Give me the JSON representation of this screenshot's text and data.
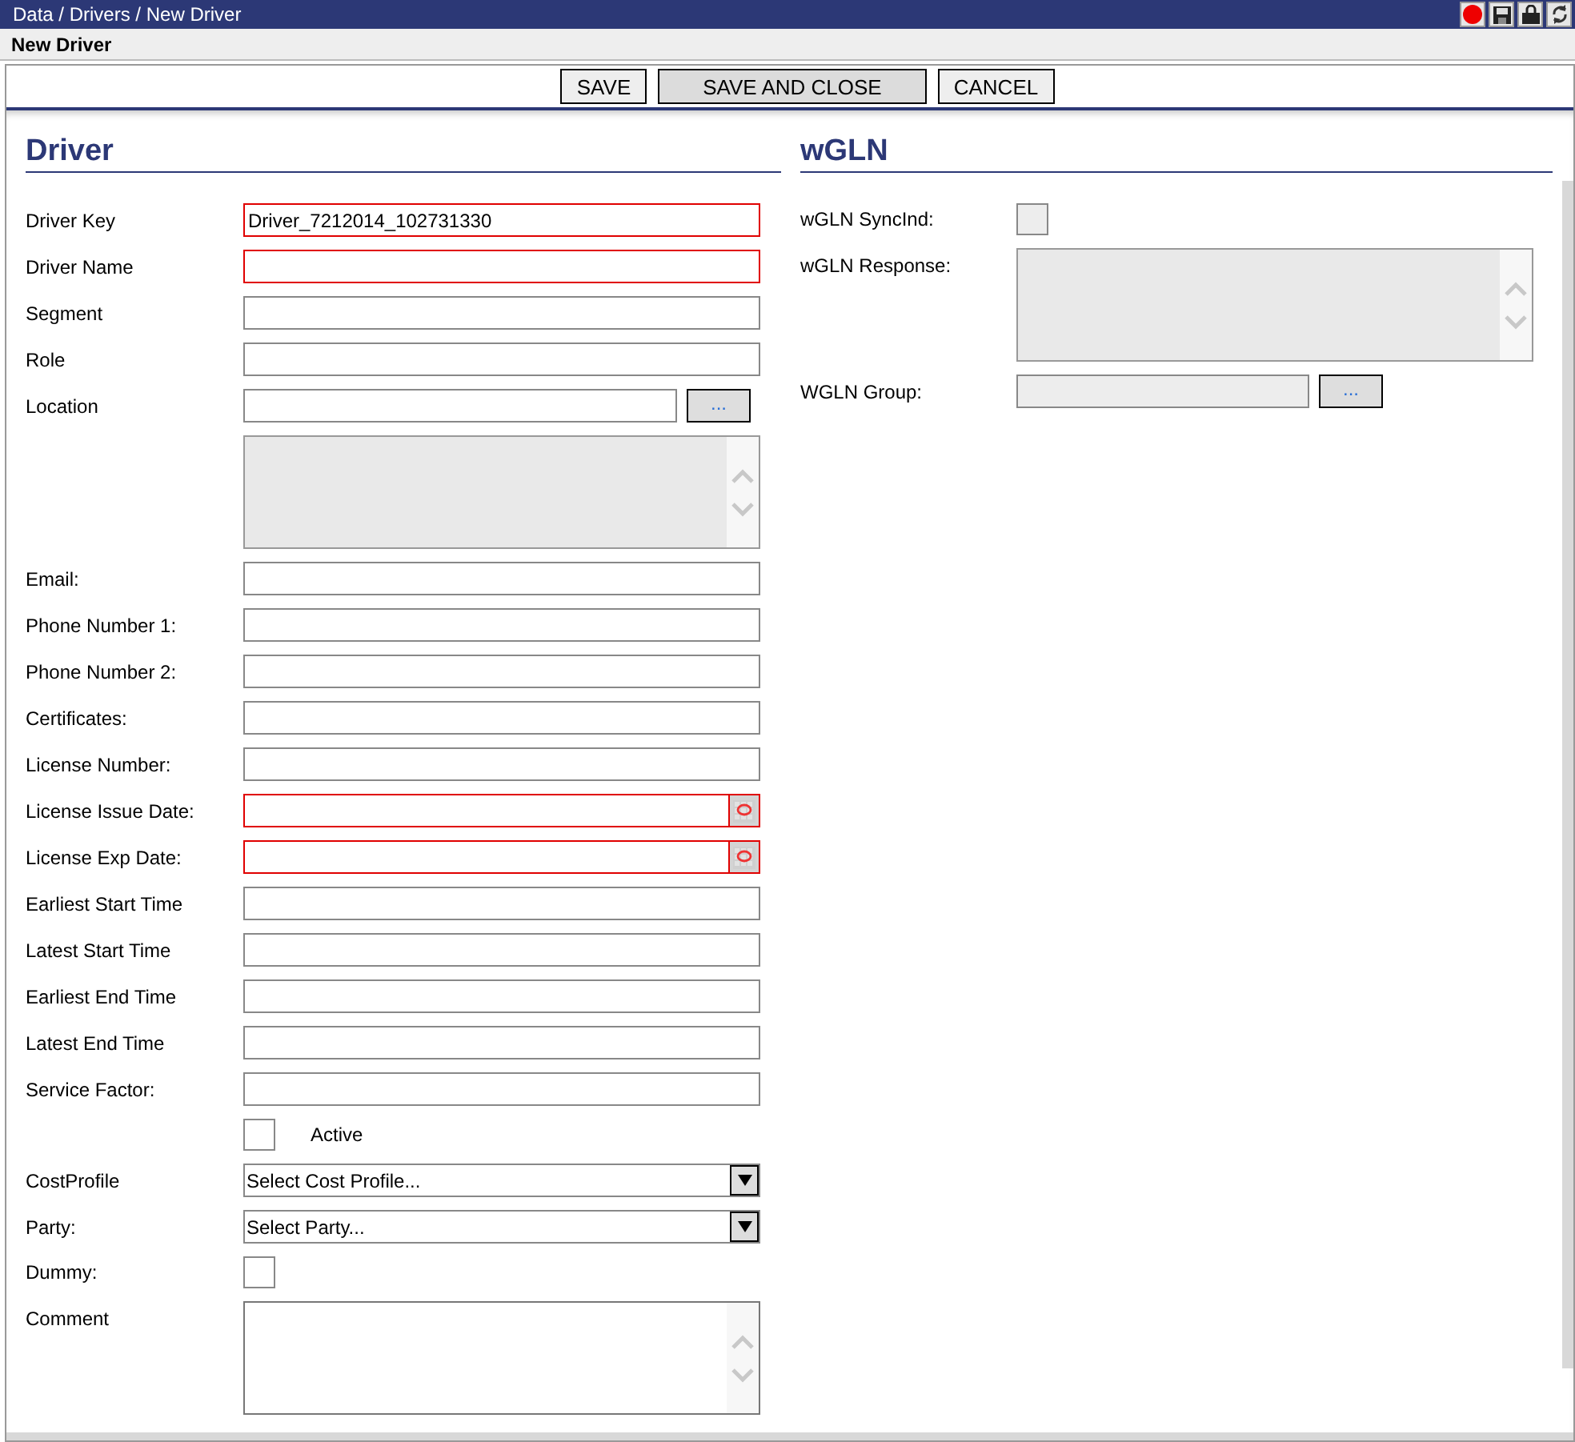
{
  "window": {
    "breadcrumb": "Data / Drivers / New Driver"
  },
  "page_title": "New Driver",
  "toolbar": {
    "buttons": [
      {
        "label": "SAVE",
        "default": false
      },
      {
        "label": "SAVE AND CLOSE",
        "default": true
      },
      {
        "label": "CANCEL",
        "default": false
      }
    ]
  },
  "driver": {
    "title": "Driver",
    "fields": [
      {
        "kind": "text",
        "label": "Driver Key",
        "value": "Driver_7212014_102731330",
        "required": true
      },
      {
        "kind": "text",
        "label": "Driver Name",
        "required": true
      },
      {
        "kind": "text",
        "label": "Segment",
        "required": false
      },
      {
        "kind": "text",
        "label": "Role",
        "required": false
      },
      {
        "kind": "lookup",
        "label": "Location",
        "button": "...",
        "required": false,
        "disabled": false
      },
      {
        "kind": "textarea",
        "disabled": true
      },
      {
        "kind": "text",
        "label": "Email:",
        "required": false
      },
      {
        "kind": "text",
        "label": "Phone Number 1:",
        "required": false
      },
      {
        "kind": "text",
        "label": "Phone Number 2:",
        "required": false
      },
      {
        "kind": "text",
        "label": "Certificates:",
        "required": false
      },
      {
        "kind": "text",
        "label": "License Number:",
        "required": false
      },
      {
        "kind": "date",
        "label": "License Issue Date:",
        "required": true
      },
      {
        "kind": "date",
        "label": "License Exp Date:",
        "required": true
      },
      {
        "kind": "text",
        "label": "Earliest Start Time",
        "required": false
      },
      {
        "kind": "text",
        "label": "Latest Start Time",
        "required": false
      },
      {
        "kind": "text",
        "label": "Earliest End Time",
        "required": false
      },
      {
        "kind": "text",
        "label": "Latest End Time",
        "required": false
      },
      {
        "kind": "text",
        "label": "Service Factor:",
        "required": false
      },
      {
        "kind": "checkbox",
        "side_label": "Active",
        "checked": false,
        "disabled": false
      },
      {
        "kind": "select",
        "label": "CostProfile",
        "value": "Select Cost Profile..."
      },
      {
        "kind": "select",
        "label": "Party:",
        "value": "Select Party..."
      },
      {
        "kind": "checkbox",
        "label": "Dummy:",
        "checked": false,
        "disabled": false
      },
      {
        "kind": "textarea",
        "label": "Comment",
        "disabled": false
      }
    ]
  },
  "wgln": {
    "title": "wGLN",
    "fields": [
      {
        "kind": "checkbox",
        "label": "wGLN SyncInd:",
        "checked": false,
        "disabled": true
      },
      {
        "kind": "textarea",
        "label": "wGLN Response:",
        "disabled": true
      },
      {
        "kind": "lookup",
        "label": "WGLN Group:",
        "button": "...",
        "required": false,
        "disabled": true
      }
    ]
  }
}
